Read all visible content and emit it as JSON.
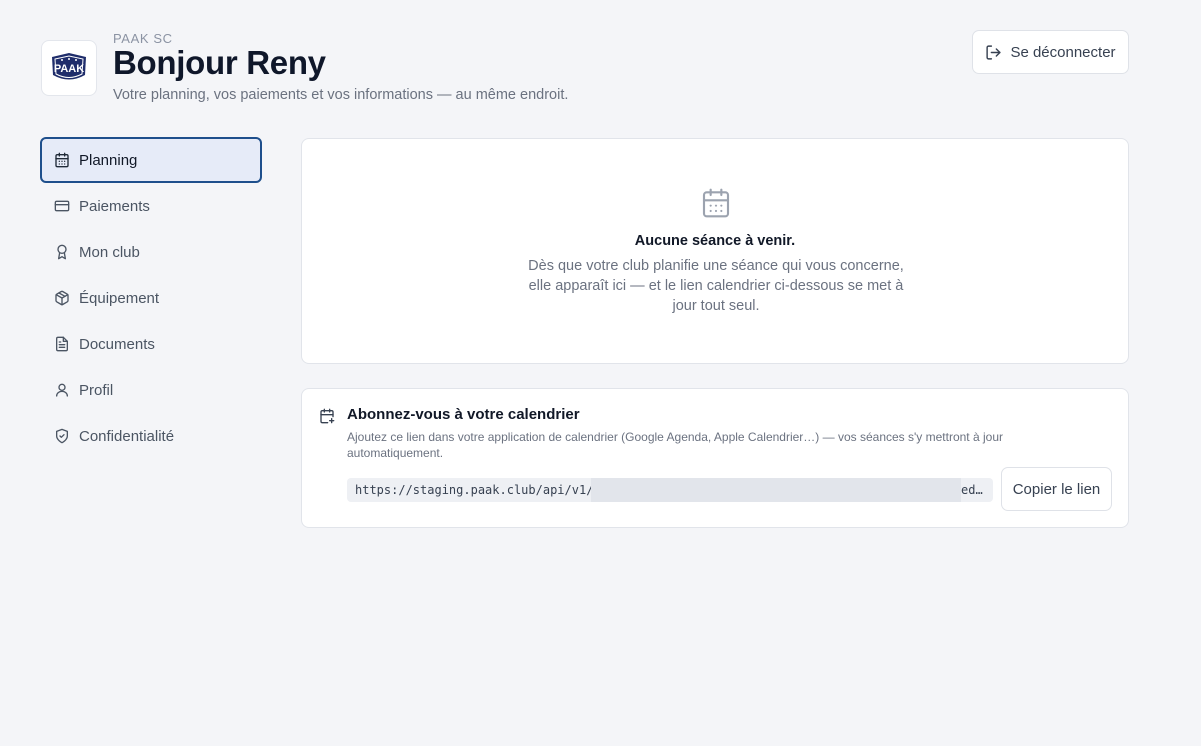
{
  "header": {
    "club_name": "PAAK SC",
    "logo_text": "PAAK",
    "greeting": "Bonjour Reny",
    "subtitle": "Votre planning, vos paiements et vos informations — au même endroit.",
    "logout_label": "Se déconnecter"
  },
  "sidebar": {
    "items": [
      {
        "label": "Planning",
        "icon": "calendar-icon",
        "active": true
      },
      {
        "label": "Paiements",
        "icon": "credit-card-icon",
        "active": false
      },
      {
        "label": "Mon club",
        "icon": "award-icon",
        "active": false
      },
      {
        "label": "Équipement",
        "icon": "package-icon",
        "active": false
      },
      {
        "label": "Documents",
        "icon": "file-text-icon",
        "active": false
      },
      {
        "label": "Profil",
        "icon": "user-icon",
        "active": false
      },
      {
        "label": "Confidentialité",
        "icon": "shield-check-icon",
        "active": false
      }
    ]
  },
  "planning": {
    "empty_icon": "calendar-icon",
    "empty_title": "Aucune séance à venir.",
    "empty_text": "Dès que votre club planifie une séance qui vous concerne, elle apparaît ici — et le lien calendrier ci-dessous se met à jour tout seul."
  },
  "calendar_sub": {
    "icon": "calendar-plus-icon",
    "title": "Abonnez-vous à votre calendrier",
    "description": "Ajoutez ce lien dans votre application de calendrier (Google Agenda, Apple Calendrier…) — vos séances s'y mettront à jour automatiquement.",
    "url_visible": "https://staging.paak.club/api/v1/",
    "url_tail": "ed…",
    "copy_label": "Copier le lien"
  },
  "colors": {
    "accent": "#1e4f8c",
    "active_bg": "#e6ebf8",
    "page_bg": "#f4f5f8"
  }
}
